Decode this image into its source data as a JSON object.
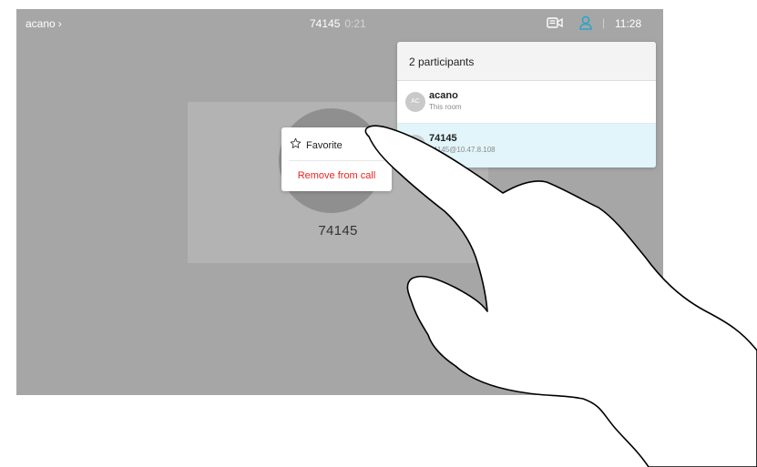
{
  "topbar": {
    "breadcrumb": "acano",
    "breadcrumb_chevron": "›",
    "call_number": "74145",
    "call_duration": "0:21",
    "divider": "|",
    "clock": "11:28",
    "icons": [
      "self-view-camera-icon",
      "participants-icon"
    ],
    "accent_color": "#2fa3c7"
  },
  "video_tile": {
    "name": "74145"
  },
  "context_menu": {
    "favorite_icon": "★",
    "favorite_label": "Favorite",
    "remove_label": "Remove from call",
    "remove_color": "#e5261f"
  },
  "participants_panel": {
    "title": "2 participants",
    "participants": [
      {
        "initials": "AC",
        "name": "acano",
        "detail": "This room"
      },
      {
        "initials": "",
        "name": "74145",
        "detail": "74145@10.47.8.108"
      }
    ],
    "selected_color": "#e1f5fa"
  },
  "overlay": {
    "icon": "pointing-hand-illustration"
  }
}
